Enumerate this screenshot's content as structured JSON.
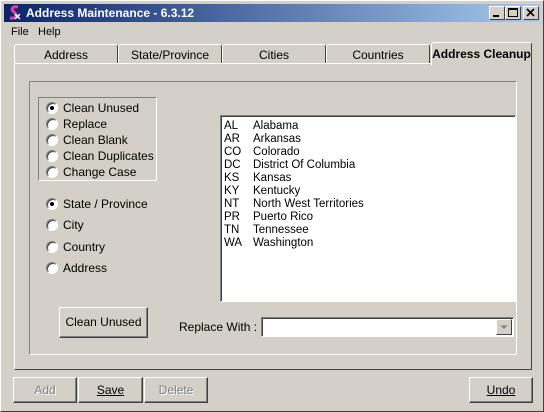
{
  "window": {
    "title": "Address Maintenance - 6.3.12",
    "controls": [
      "minimize-icon",
      "maximize-icon",
      "close-icon"
    ]
  },
  "menu": {
    "items": [
      "File",
      "Help"
    ]
  },
  "tabs": [
    {
      "label": "Address",
      "active": false
    },
    {
      "label": "State/Province",
      "active": false
    },
    {
      "label": "Cities",
      "active": false
    },
    {
      "label": "Countries",
      "active": false
    },
    {
      "label": "Address Cleanup",
      "active": true
    }
  ],
  "cleanup": {
    "actions": [
      {
        "label": "Clean Unused",
        "selected": true
      },
      {
        "label": "Replace",
        "selected": false
      },
      {
        "label": "Clean Blank",
        "selected": false
      },
      {
        "label": "Clean Duplicates",
        "selected": false
      },
      {
        "label": "Change Case",
        "selected": false
      }
    ],
    "targets": [
      {
        "label": "State / Province",
        "selected": true
      },
      {
        "label": "City",
        "selected": false
      },
      {
        "label": "Country",
        "selected": false
      },
      {
        "label": "Address",
        "selected": false
      }
    ],
    "list": [
      {
        "code": "AL",
        "name": "Alabama"
      },
      {
        "code": "AR",
        "name": "Arkansas"
      },
      {
        "code": "CO",
        "name": "Colorado"
      },
      {
        "code": "DC",
        "name": "District Of Columbia"
      },
      {
        "code": "KS",
        "name": "Kansas"
      },
      {
        "code": "KY",
        "name": "Kentucky"
      },
      {
        "code": "NT",
        "name": "North West Territories"
      },
      {
        "code": "PR",
        "name": "Puerto Rico"
      },
      {
        "code": "TN",
        "name": "Tennessee"
      },
      {
        "code": "WA",
        "name": "Washington"
      }
    ],
    "action_button": "Clean Unused",
    "replace_label": "Replace With :",
    "replace_value": ""
  },
  "footer": {
    "add": "Add",
    "save": "Save",
    "delete": "Delete",
    "undo": "Undo",
    "add_enabled": false,
    "delete_enabled": false
  }
}
